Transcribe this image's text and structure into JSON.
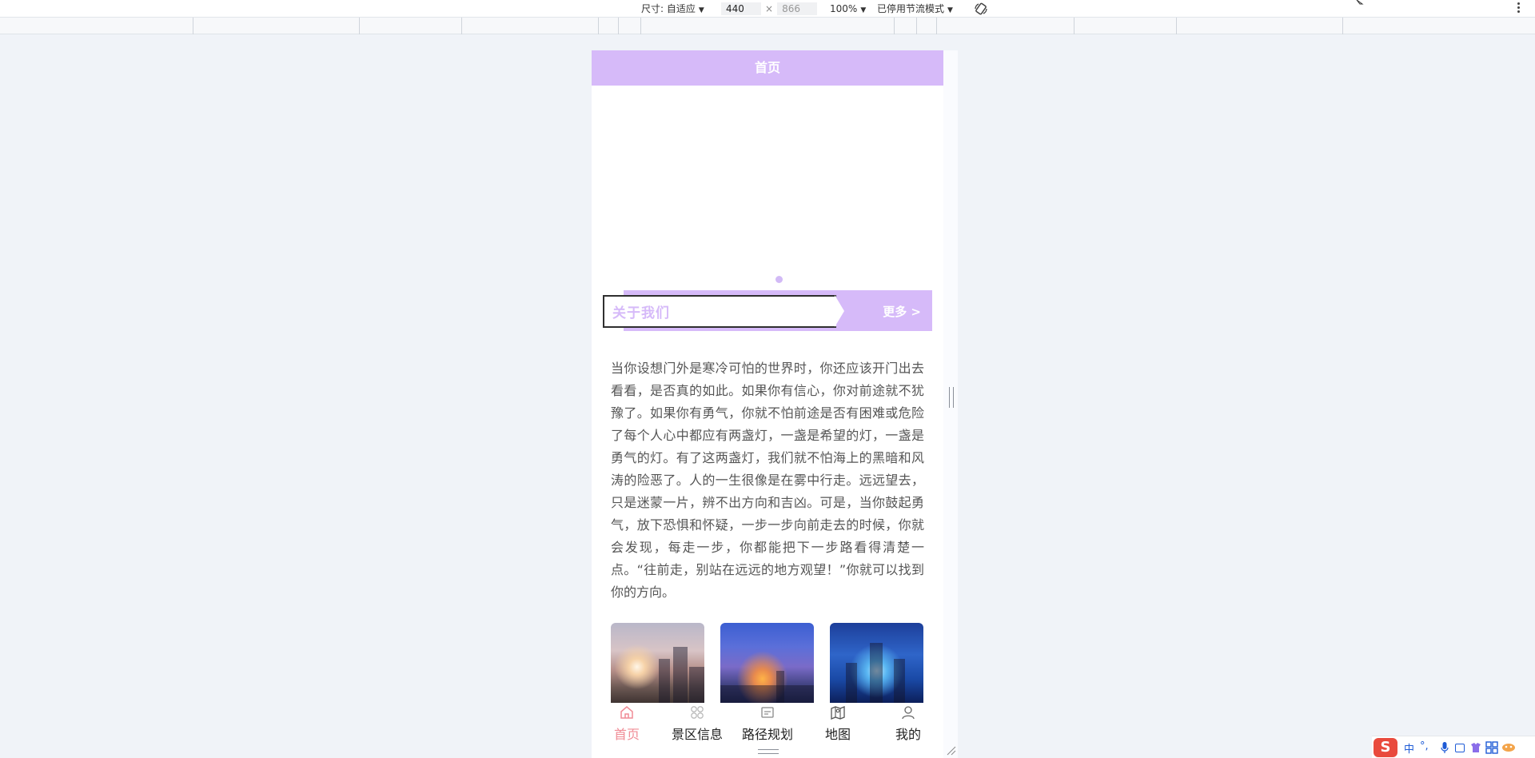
{
  "devtools": {
    "size_label": "尺寸: 自适应",
    "width_value": "440",
    "times": "×",
    "height_placeholder": "866",
    "zoom_label": "100%",
    "throttle_label": "已停用节流模式"
  },
  "app": {
    "header_title": "首页",
    "about": {
      "title": "关于我们",
      "more_label": "更多 >"
    },
    "article_text": "当你设想门外是寒冷可怕的世界时，你还应该开门出去看看，是否真的如此。如果你有信心，你对前途就不犹豫了。如果你有勇气，你就不怕前途是否有困难或危险了每个人心中都应有两盏灯，一盏是希望的灯，一盏是勇气的灯。有了这两盏灯，我们就不怕海上的黑暗和风涛的险恶了。人的一生很像是在雾中行走。远远望去，只是迷蒙一片，辨不出方向和吉凶。可是，当你鼓起勇气，放下恐惧和怀疑，一步一步向前走去的时候，你就会发现，每走一步，你都能把下一步路看得清楚一点。“往前走，别站在远远的地方观望！”你就可以找到你的方向。",
    "tabs": [
      {
        "label": "首页",
        "icon": "home-icon",
        "active": true
      },
      {
        "label": "景区信息",
        "icon": "grid-icon",
        "active": false
      },
      {
        "label": "路径规划",
        "icon": "route-icon",
        "active": false
      },
      {
        "label": "地图",
        "icon": "map-icon",
        "active": false
      },
      {
        "label": "我的",
        "icon": "user-icon",
        "active": false
      }
    ]
  },
  "tray": {
    "ime_logo": "S",
    "ime_mode": "中"
  },
  "colors": {
    "header_bg": "#d6baf9",
    "active_tab": "#f08c96",
    "text": "#555555"
  }
}
